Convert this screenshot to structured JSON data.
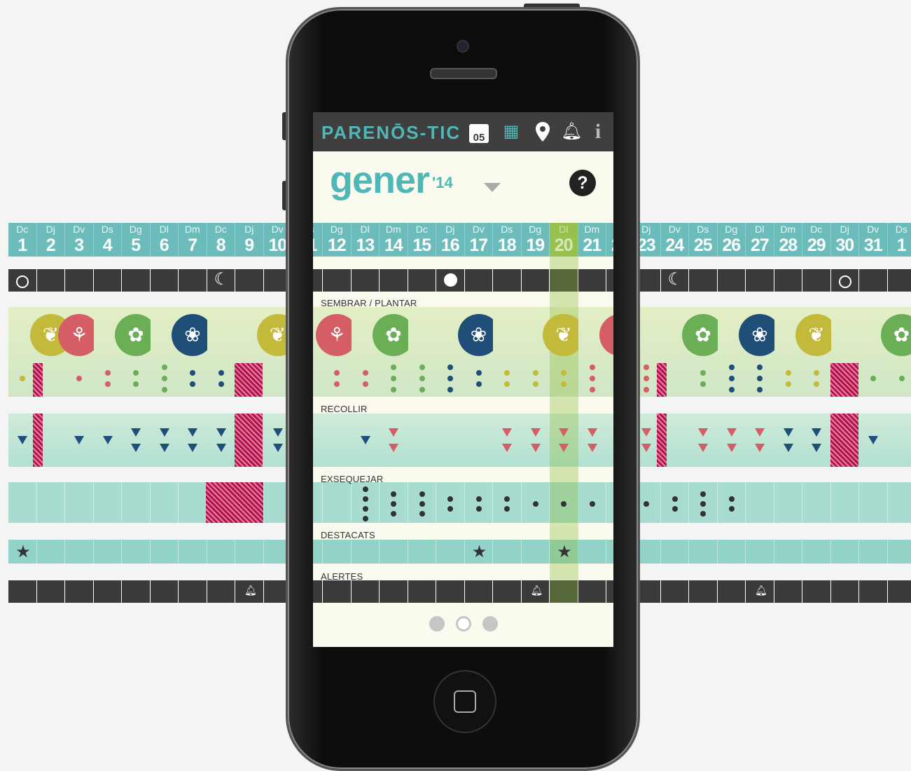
{
  "app": {
    "logo": "PARENŌS-TIC",
    "today_badge": "05",
    "icons": [
      "calendar-today-icon",
      "calendar-month-icon",
      "location-pin-icon",
      "bell-icon",
      "info-icon"
    ]
  },
  "month_header": {
    "month": "gener",
    "year": "'14",
    "help": "?"
  },
  "sections": {
    "sow": "SEMBRAR / PLANTAR",
    "harvest": "RECOLLIR",
    "dispose": "EXSEQUEJAR",
    "highlights": "DESTACATS",
    "alerts": "ALERTES"
  },
  "days": [
    {
      "wd": "Dc",
      "n": "1"
    },
    {
      "wd": "Dj",
      "n": "2"
    },
    {
      "wd": "Dv",
      "n": "3"
    },
    {
      "wd": "Ds",
      "n": "4"
    },
    {
      "wd": "Dg",
      "n": "5"
    },
    {
      "wd": "Dl",
      "n": "6"
    },
    {
      "wd": "Dm",
      "n": "7"
    },
    {
      "wd": "Dc",
      "n": "8"
    },
    {
      "wd": "Dj",
      "n": "9"
    },
    {
      "wd": "Dv",
      "n": "10"
    },
    {
      "wd": "Ds",
      "n": "11"
    },
    {
      "wd": "Dg",
      "n": "12"
    },
    {
      "wd": "Dl",
      "n": "13"
    },
    {
      "wd": "Dm",
      "n": "14"
    },
    {
      "wd": "Dc",
      "n": "15"
    },
    {
      "wd": "Dj",
      "n": "16"
    },
    {
      "wd": "Dv",
      "n": "17"
    },
    {
      "wd": "Ds",
      "n": "18"
    },
    {
      "wd": "Dg",
      "n": "19"
    },
    {
      "wd": "Dl",
      "n": "20"
    },
    {
      "wd": "Dm",
      "n": "21"
    },
    {
      "wd": "Dc",
      "n": "22"
    },
    {
      "wd": "Dj",
      "n": "23"
    },
    {
      "wd": "Dv",
      "n": "24"
    },
    {
      "wd": "Ds",
      "n": "25"
    },
    {
      "wd": "Dg",
      "n": "26"
    },
    {
      "wd": "Dl",
      "n": "27"
    },
    {
      "wd": "Dm",
      "n": "28"
    },
    {
      "wd": "Dc",
      "n": "29"
    },
    {
      "wd": "Dj",
      "n": "30"
    },
    {
      "wd": "Dv",
      "n": "31"
    },
    {
      "wd": "Ds",
      "n": "1"
    }
  ],
  "selected_day": 20,
  "moon_phases": [
    {
      "day": 1,
      "phase": "new"
    },
    {
      "day": 8,
      "phase": "first-quarter"
    },
    {
      "day": 16,
      "phase": "full"
    },
    {
      "day": 24,
      "phase": "last-quarter"
    },
    {
      "day": 30,
      "phase": "new"
    }
  ],
  "sow_icons": [
    {
      "day": 2,
      "kind": "fruit-icon",
      "color": "#c3b93a"
    },
    {
      "day": 3,
      "kind": "root-icon",
      "color": "#d45d66"
    },
    {
      "day": 5,
      "kind": "flower-icon",
      "color": "#6aae55"
    },
    {
      "day": 7,
      "kind": "leaf-icon",
      "color": "#1f4f78"
    },
    {
      "day": 10,
      "kind": "fruit-icon",
      "color": "#c3b93a"
    },
    {
      "day": 12,
      "kind": "root-icon",
      "color": "#d45d66"
    },
    {
      "day": 14,
      "kind": "flower-icon",
      "color": "#6aae55"
    },
    {
      "day": 17,
      "kind": "leaf-icon",
      "color": "#1f4f78"
    },
    {
      "day": 20,
      "kind": "fruit-icon",
      "color": "#c3b93a"
    },
    {
      "day": 22,
      "kind": "root-icon",
      "color": "#d45d66"
    },
    {
      "day": 25,
      "kind": "flower-icon",
      "color": "#6aae55"
    },
    {
      "day": 27,
      "kind": "leaf-icon",
      "color": "#1f4f78"
    },
    {
      "day": 29,
      "kind": "fruit-icon",
      "color": "#c3b93a"
    },
    {
      "day": 32,
      "kind": "flower-icon",
      "color": "#6aae55"
    }
  ],
  "sow_dots": [
    {
      "day": 1,
      "n": 1,
      "c": "#c3b93a"
    },
    {
      "day": 3,
      "n": 1,
      "c": "#d45d66"
    },
    {
      "day": 4,
      "n": 2,
      "c": "#d45d66"
    },
    {
      "day": 5,
      "n": 2,
      "c": "#6aae55"
    },
    {
      "day": 6,
      "n": 3,
      "c": "#6aae55"
    },
    {
      "day": 7,
      "n": 2,
      "c": "#1f4f78"
    },
    {
      "day": 8,
      "n": 2,
      "c": "#1f4f78"
    },
    {
      "day": 9,
      "n": 1,
      "c": "#1f4f78"
    },
    {
      "day": 11,
      "n": 3,
      "c": "#c3b93a"
    },
    {
      "day": 12,
      "n": 2,
      "c": "#d45d66"
    },
    {
      "day": 13,
      "n": 2,
      "c": "#d45d66"
    },
    {
      "day": 14,
      "n": 3,
      "c": "#6aae55"
    },
    {
      "day": 15,
      "n": 3,
      "c": "#6aae55"
    },
    {
      "day": 16,
      "n": 3,
      "c": "#1f4f78"
    },
    {
      "day": 17,
      "n": 2,
      "c": "#1f4f78"
    },
    {
      "day": 18,
      "n": 2,
      "c": "#c3b93a"
    },
    {
      "day": 19,
      "n": 2,
      "c": "#c3b93a"
    },
    {
      "day": 20,
      "n": 2,
      "c": "#c3b93a"
    },
    {
      "day": 21,
      "n": 3,
      "c": "#d45d66"
    },
    {
      "day": 23,
      "n": 3,
      "c": "#d45d66"
    },
    {
      "day": 25,
      "n": 2,
      "c": "#6aae55"
    },
    {
      "day": 26,
      "n": 3,
      "c": "#1f4f78"
    },
    {
      "day": 27,
      "n": 3,
      "c": "#1f4f78"
    },
    {
      "day": 28,
      "n": 2,
      "c": "#c3b93a"
    },
    {
      "day": 29,
      "n": 2,
      "c": "#c3b93a"
    },
    {
      "day": 31,
      "n": 1,
      "c": "#6aae55"
    },
    {
      "day": 32,
      "n": 1,
      "c": "#6aae55"
    }
  ],
  "harvest_marks": [
    {
      "day": 1,
      "n": 1,
      "c": "#1e4f78"
    },
    {
      "day": 3,
      "n": 1,
      "c": "#1e4f78"
    },
    {
      "day": 4,
      "n": 1,
      "c": "#1e4f78"
    },
    {
      "day": 5,
      "n": 2,
      "c": "#1e4f78"
    },
    {
      "day": 6,
      "n": 2,
      "c": "#1e4f78"
    },
    {
      "day": 7,
      "n": 2,
      "c": "#1e4f78"
    },
    {
      "day": 8,
      "n": 2,
      "c": "#1e4f78"
    },
    {
      "day": 10,
      "n": 2,
      "c": "#1e4f78"
    },
    {
      "day": 13,
      "n": 1,
      "c": "#1e4f78"
    },
    {
      "day": 14,
      "n": 2,
      "c": "#d45d66"
    },
    {
      "day": 18,
      "n": 2,
      "c": "#d45d66"
    },
    {
      "day": 19,
      "n": 2,
      "c": "#d45d66"
    },
    {
      "day": 20,
      "n": 2,
      "c": "#d45d66"
    },
    {
      "day": 21,
      "n": 2,
      "c": "#d45d66"
    },
    {
      "day": 23,
      "n": 2,
      "c": "#d45d66"
    },
    {
      "day": 25,
      "n": 2,
      "c": "#d45d66"
    },
    {
      "day": 26,
      "n": 2,
      "c": "#d45d66"
    },
    {
      "day": 27,
      "n": 2,
      "c": "#d45d66"
    },
    {
      "day": 28,
      "n": 2,
      "c": "#1e4f78"
    },
    {
      "day": 29,
      "n": 2,
      "c": "#1e4f78"
    },
    {
      "day": 31,
      "n": 1,
      "c": "#1e4f78"
    }
  ],
  "dispose_dots": [
    {
      "day": 13,
      "n": 4
    },
    {
      "day": 14,
      "n": 3
    },
    {
      "day": 15,
      "n": 3
    },
    {
      "day": 16,
      "n": 2
    },
    {
      "day": 17,
      "n": 2
    },
    {
      "day": 18,
      "n": 2
    },
    {
      "day": 19,
      "n": 1
    },
    {
      "day": 20,
      "n": 1
    },
    {
      "day": 21,
      "n": 1
    },
    {
      "day": 23,
      "n": 1
    },
    {
      "day": 24,
      "n": 2
    },
    {
      "day": 25,
      "n": 3
    },
    {
      "day": 26,
      "n": 2
    }
  ],
  "blocked_days": [
    2,
    9,
    24,
    30
  ],
  "highlight_days": [
    1,
    17,
    20
  ],
  "alert_days": [
    9,
    19,
    27
  ],
  "pager": {
    "count": 3,
    "active": 1
  },
  "colors": {
    "teal": "#4fb8b7",
    "fruit": "#c3b93a",
    "root": "#d45d66",
    "flower": "#6aae55",
    "leaf": "#1f4f78",
    "dark": "#3a3a3a",
    "hatch": "#b0134f"
  }
}
